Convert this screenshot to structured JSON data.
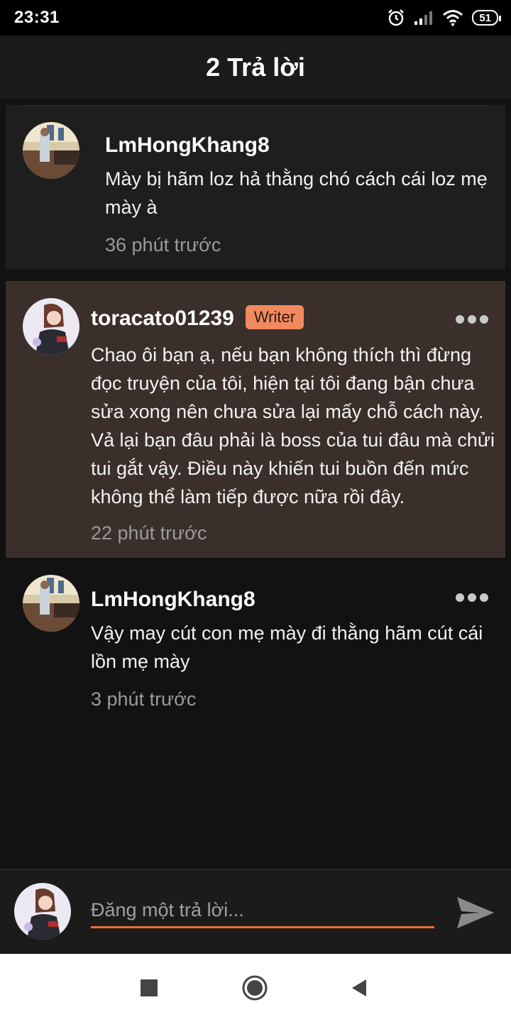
{
  "status_bar": {
    "time": "23:31",
    "battery": "51"
  },
  "header": {
    "title": "2 Trả lời"
  },
  "comments": [
    {
      "username": "LmHongKhang8",
      "text": "Mày bị hãm loz hả thằng chó cách cái loz mẹ mày à",
      "timestamp": "36 phút trước",
      "highlighted": false
    },
    {
      "username": "toracato01239",
      "badge": "Writer",
      "text": "Chao ôi bạn ạ, nếu bạn không thích thì đừng đọc truyện của tôi, hiện tại tôi đang bận chưa sửa xong nên chưa sửa lại mấy chỗ cách này. Vả lại bạn đâu phải là boss của tui đâu mà chửi tui gắt vậy. Điều này khiến tui buồn đến mức không thể làm tiếp được nữa rồi đây.",
      "timestamp": "22 phút trước",
      "highlighted": true
    },
    {
      "username": "LmHongKhang8",
      "text": "Vậy may cút con mẹ mày đi thằng hãm cút cái lồn mẹ mày",
      "timestamp": "3 phút trước",
      "highlighted": false
    }
  ],
  "composer": {
    "placeholder": "Đăng một trả lời..."
  },
  "colors": {
    "accent": "#f26b3a",
    "badge": "#f08a5e",
    "highlight_card": "#3a2f2b",
    "background": "#121212"
  },
  "icons": [
    "alarm-icon",
    "signal-icon",
    "wifi-icon",
    "battery-icon",
    "more-icon",
    "send-icon",
    "recents-icon",
    "home-icon",
    "back-icon"
  ]
}
